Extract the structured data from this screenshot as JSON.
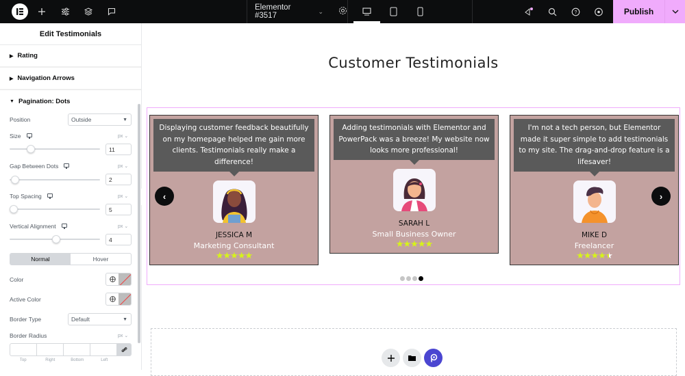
{
  "topbar": {
    "document_title": "Elementor #3517",
    "publish_label": "Publish",
    "icons": [
      "elementor-logo-icon",
      "add-element-icon",
      "site-settings-icon",
      "structure-icon",
      "comments-icon",
      "page-settings-icon",
      "desktop-icon",
      "tablet-icon",
      "mobile-icon",
      "whats-new-icon",
      "search-icon",
      "help-icon",
      "preview-icon",
      "chevron-down-icon"
    ],
    "active_device": "desktop",
    "notification_color": "#f0abfc"
  },
  "panel": {
    "title": "Edit Testimonials",
    "sections": [
      {
        "label": "Rating",
        "open": false
      },
      {
        "label": "Navigation Arrows",
        "open": false
      },
      {
        "label": "Pagination: Dots",
        "open": true
      }
    ],
    "position": {
      "label": "Position",
      "value": "Outside"
    },
    "size": {
      "label": "Size",
      "unit": "px",
      "value": "11"
    },
    "gap": {
      "label": "Gap Between Dots",
      "unit": "px",
      "value": "2"
    },
    "top_spacing": {
      "label": "Top Spacing",
      "unit": "px",
      "value": "5"
    },
    "vertical_alignment": {
      "label": "Vertical Alignment",
      "unit": "px",
      "value": "4"
    },
    "state_tabs": [
      "Normal",
      "Hover"
    ],
    "active_state": "Normal",
    "color": {
      "label": "Color"
    },
    "active_color": {
      "label": "Active Color"
    },
    "border_type": {
      "label": "Border Type",
      "value": "Default"
    },
    "border_radius": {
      "label": "Border Radius",
      "unit": "px",
      "sides": [
        "Top",
        "Right",
        "Bottom",
        "Left"
      ]
    }
  },
  "canvas": {
    "heading": "Customer Testimonials",
    "testimonials": [
      {
        "quote": "Displaying customer feedback beautifully on my homepage helped me gain more clients. Testimonials really make a difference!",
        "name": "JESSICA M",
        "role": "Marketing Consultant",
        "rating": 5,
        "stars": "★★★★★"
      },
      {
        "quote": "Adding testimonials with Elementor and PowerPack was a breeze! My website now looks more professional!",
        "name": "SARAH L",
        "role": "Small Business Owner",
        "rating": 5,
        "stars": "★★★★★"
      },
      {
        "quote": "I'm not a tech person, but Elementor made it super simple to add testimonials to my site. The drag-and-drop feature is a lifesaver!",
        "name": "MIKE D",
        "role": "Freelancer",
        "rating": 4.5,
        "stars": "★★★★"
      }
    ],
    "pagination": {
      "total": 4,
      "active": 4
    },
    "card_color": "#c3a2a0",
    "star_color": "#d6f31a",
    "accent": "#f0abfc"
  }
}
